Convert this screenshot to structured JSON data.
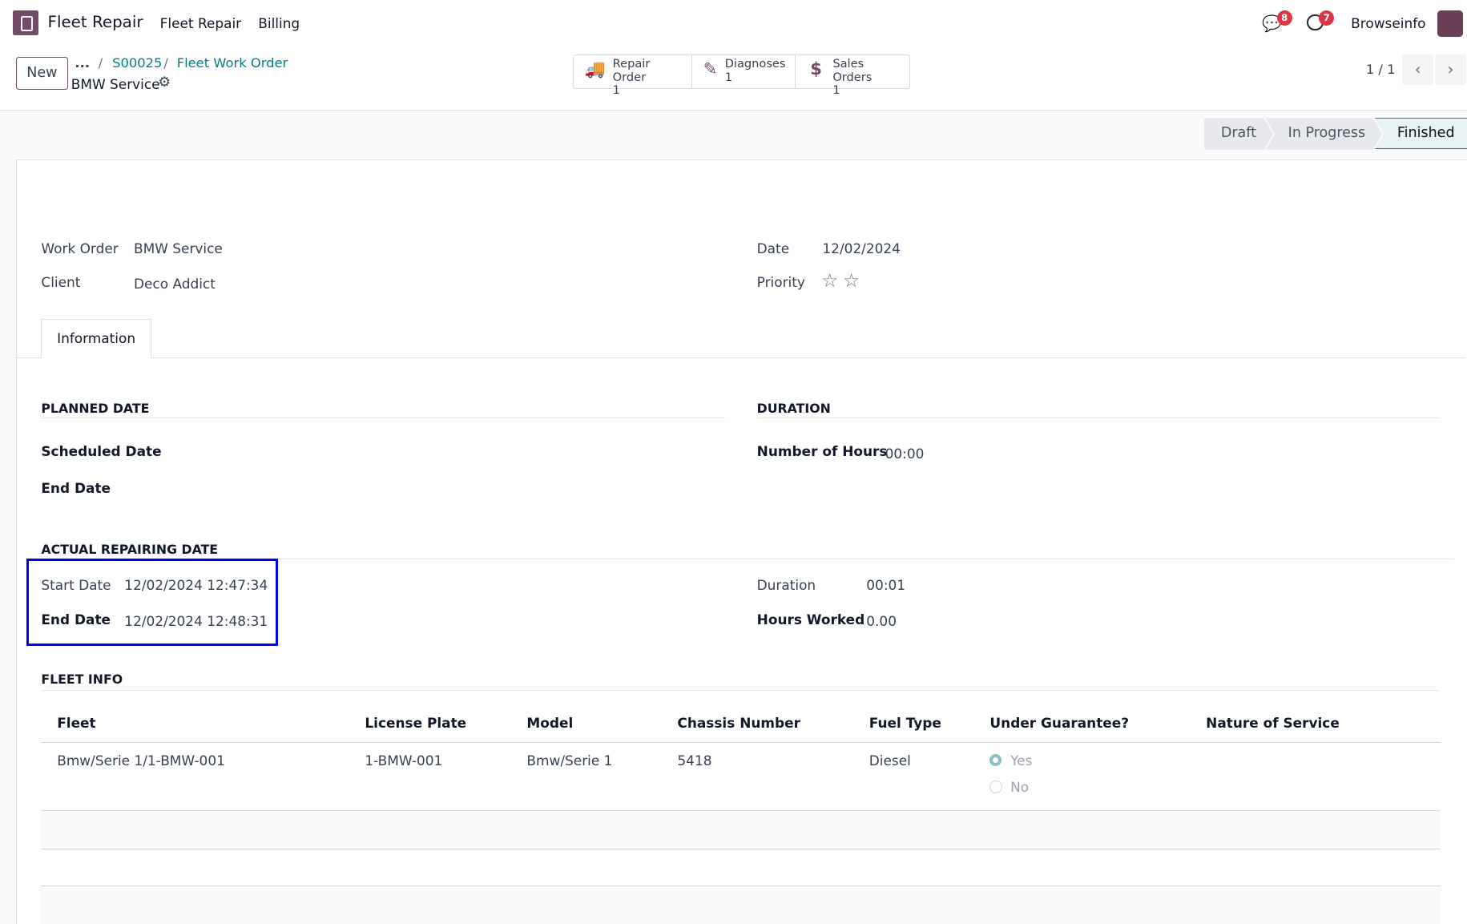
{
  "nav": {
    "app": "Fleet Repair",
    "menu": [
      "Fleet Repair",
      "Billing"
    ],
    "messages_count": "8",
    "activities_count": "7",
    "user": "Browseinfo"
  },
  "control": {
    "new_label": "New",
    "breadcrumb": [
      "...",
      "S00025",
      "Fleet Work Order"
    ],
    "record": "BMW Service",
    "pager": "1 / 1",
    "smart_buttons": [
      {
        "label": "Repair Order",
        "count": "1"
      },
      {
        "label": "Diagnoses",
        "count": "1"
      },
      {
        "label": "Sales Orders",
        "count": "1"
      }
    ]
  },
  "statusbar": {
    "stages": [
      "Draft",
      "In Progress",
      "Finished"
    ],
    "active": "Finished"
  },
  "form": {
    "work_order_label": "Work Order",
    "work_order": "BMW Service",
    "client_label": "Client",
    "client": "Deco Addict",
    "date_label": "Date",
    "date": "12/02/2024",
    "priority_label": "Priority",
    "priority_stars": 0,
    "priority_max": 2
  },
  "tabs": [
    "Information"
  ],
  "planned": {
    "title": "PLANNED DATE",
    "scheduled_label": "Scheduled Date",
    "end_label": "End Date"
  },
  "duration": {
    "title": "DURATION",
    "hours_label": "Number of Hours",
    "hours": "00:00"
  },
  "actual": {
    "title": "ACTUAL REPAIRING DATE",
    "start_label": "Start Date",
    "start": "12/02/2024 12:47:34",
    "end_label": "End Date",
    "end": "12/02/2024 12:48:31",
    "duration_label": "Duration",
    "duration": "00:01",
    "worked_label": "Hours Worked",
    "worked": "0.00"
  },
  "fleet": {
    "title": "FLEET INFO",
    "columns": [
      "Fleet",
      "License Plate",
      "Model",
      "Chassis Number",
      "Fuel Type",
      "Under Guarantee?",
      "Nature of Service"
    ],
    "rows": [
      {
        "fleet": "Bmw/Serie 1/1-BMW-001",
        "plate": "1-BMW-001",
        "model": "Bmw/Serie 1",
        "chassis": "5418",
        "fuel": "Diesel",
        "guarantee_options": [
          "Yes",
          "No"
        ],
        "guarantee": "Yes",
        "nature": ""
      }
    ]
  },
  "colors": {
    "brand": "#714B67",
    "link": "#017e84",
    "highlight": "#0000ff"
  }
}
